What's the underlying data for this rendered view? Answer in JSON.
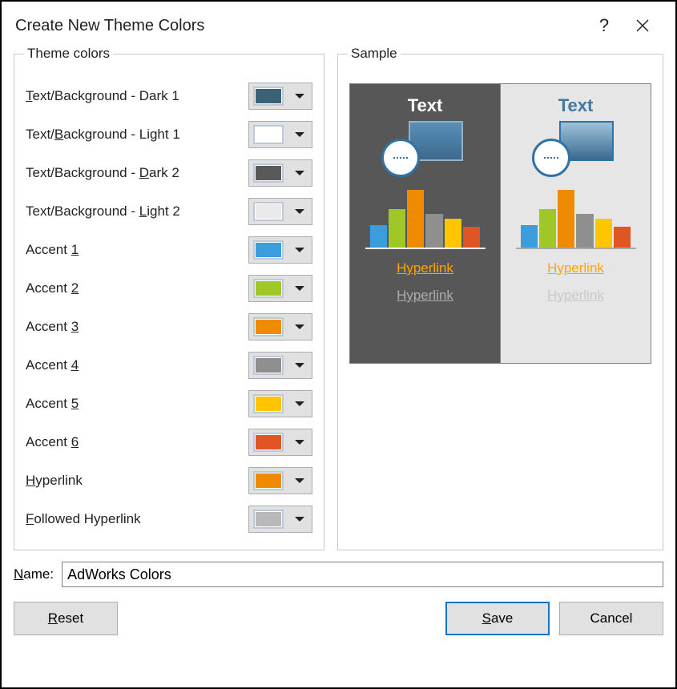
{
  "dialog": {
    "title": "Create New Theme Colors",
    "help": "?",
    "close": "✕"
  },
  "theme_colors_legend": "Theme colors",
  "sample_legend": "Sample",
  "colors": [
    {
      "label_pre": "",
      "u": "T",
      "label_post": "ext/Background - Dark 1",
      "value": "#3b6178"
    },
    {
      "label_pre": "Text/",
      "u": "B",
      "label_post": "ackground - Light 1",
      "value": "#ffffff"
    },
    {
      "label_pre": "Text/Background - ",
      "u": "D",
      "label_post": "ark 2",
      "value": "#595959"
    },
    {
      "label_pre": "Text/Background - ",
      "u": "L",
      "label_post": "ight 2",
      "value": "#eaeaea"
    },
    {
      "label_pre": "Accent ",
      "u": "1",
      "label_post": "",
      "value": "#3c9ddc"
    },
    {
      "label_pre": "Accent ",
      "u": "2",
      "label_post": "",
      "value": "#9fc826"
    },
    {
      "label_pre": "Accent ",
      "u": "3",
      "label_post": "",
      "value": "#ef8b00"
    },
    {
      "label_pre": "Accent ",
      "u": "4",
      "label_post": "",
      "value": "#8f8f8f"
    },
    {
      "label_pre": "Accent ",
      "u": "5",
      "label_post": "",
      "value": "#ffc600"
    },
    {
      "label_pre": "Accent ",
      "u": "6",
      "label_post": "",
      "value": "#e15424"
    },
    {
      "label_pre": "",
      "u": "H",
      "label_post": "yperlink",
      "value": "#ef8b00"
    },
    {
      "label_pre": "",
      "u": "F",
      "label_post": "ollowed Hyperlink",
      "value": "#b9b9b9"
    }
  ],
  "sample": {
    "text_label": "Text",
    "hyperlink_label": "Hyperlink",
    "followed_label": "Hyperlink",
    "bars": [
      {
        "color": "#3c9ddc",
        "h": 28
      },
      {
        "color": "#9fc826",
        "h": 48
      },
      {
        "color": "#ef8b00",
        "h": 72
      },
      {
        "color": "#8f8f8f",
        "h": 42
      },
      {
        "color": "#ffc600",
        "h": 36
      },
      {
        "color": "#e15424",
        "h": 26
      }
    ]
  },
  "name_label_u": "N",
  "name_label_post": "ame:",
  "name_value": "AdWorks Colors",
  "buttons": {
    "reset_u": "R",
    "reset_post": "eset",
    "save_u": "S",
    "save_post": "ave",
    "cancel": "Cancel"
  }
}
